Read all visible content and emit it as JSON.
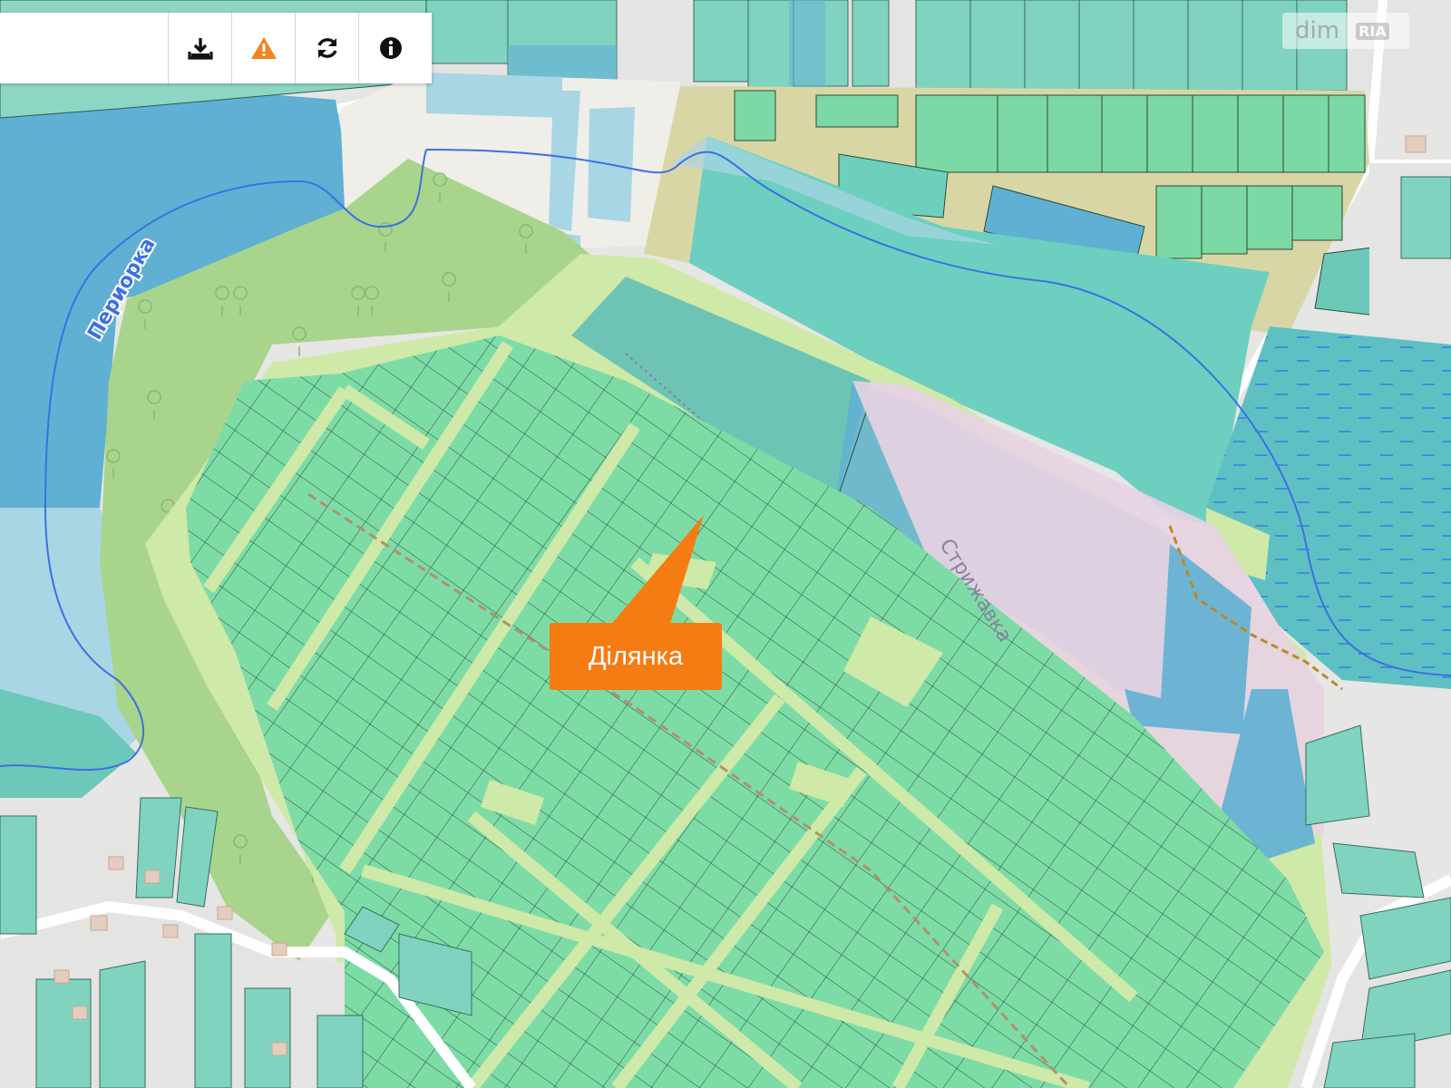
{
  "toolbar": {
    "buttons": [
      {
        "id": "download",
        "icon": "download-icon"
      },
      {
        "id": "report",
        "icon": "warning-icon",
        "color": "#f58220"
      },
      {
        "id": "refresh",
        "icon": "refresh-icon"
      },
      {
        "id": "info",
        "icon": "info-icon"
      }
    ]
  },
  "map": {
    "labels": {
      "river": "Периорка",
      "street": "Стрижавка"
    },
    "marker": {
      "label": "Ділянка",
      "color": "#f57c12"
    },
    "colors": {
      "parcel": "#7ddca6",
      "parcel_teal": "#6cd0bc",
      "forest": "#a8d48c",
      "grass": "#cfe9a8",
      "water": "#5fb0d3",
      "water_light": "#a9d6e4",
      "residential": "#e2e2e0",
      "farmland": "#d9d6a6",
      "pink_zone": "#e8d3e3",
      "wetland": "#5fb9c7",
      "river_line": "#3d6fe3"
    }
  },
  "watermark": {
    "text": "dim",
    "badge": "RIA"
  }
}
